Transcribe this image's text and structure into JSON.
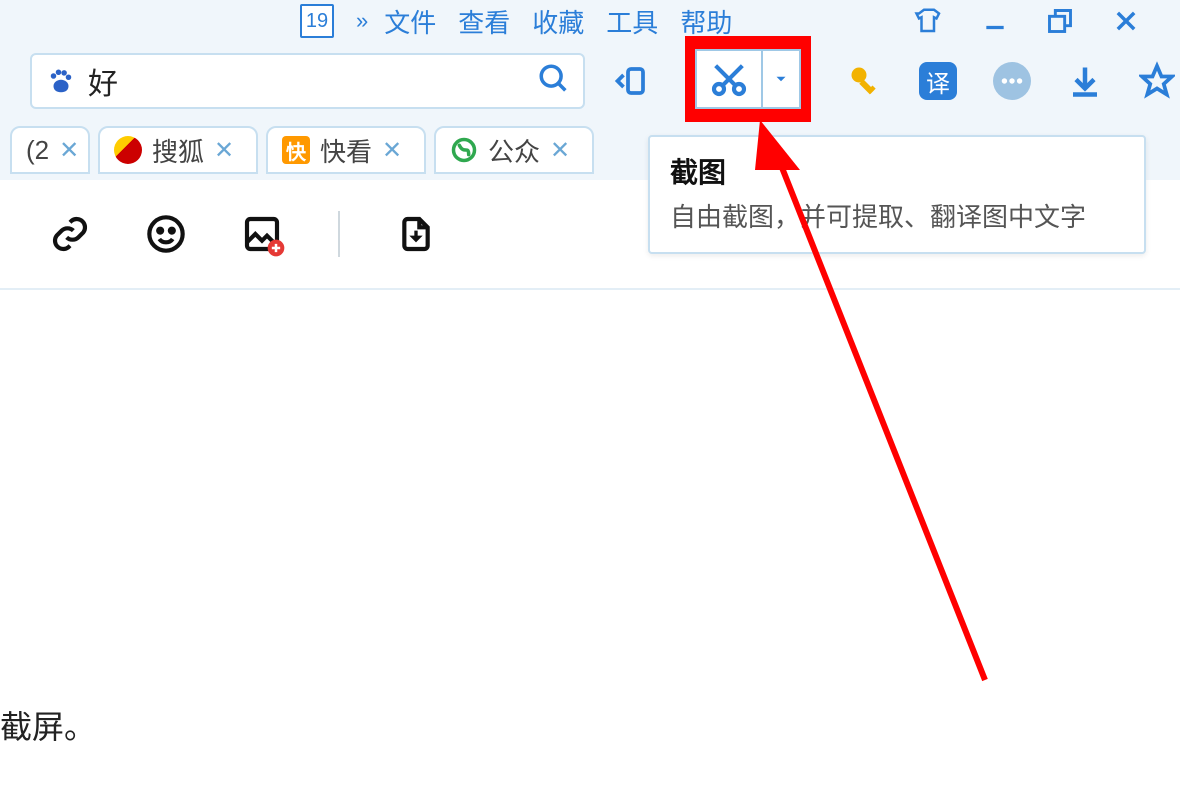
{
  "menubar": {
    "date": "19",
    "items": [
      "文件",
      "查看",
      "收藏",
      "工具",
      "帮助"
    ]
  },
  "search": {
    "value": "好"
  },
  "tabs": [
    {
      "label": "(2"
    },
    {
      "label": "搜狐"
    },
    {
      "label": "快看"
    },
    {
      "label": "公众"
    }
  ],
  "tooltip": {
    "title": "截图",
    "desc": "自由截图，并可提取、翻译图中文字"
  },
  "toolbar": {
    "translate_badge": "译"
  },
  "content": {
    "text": "截屏。"
  }
}
